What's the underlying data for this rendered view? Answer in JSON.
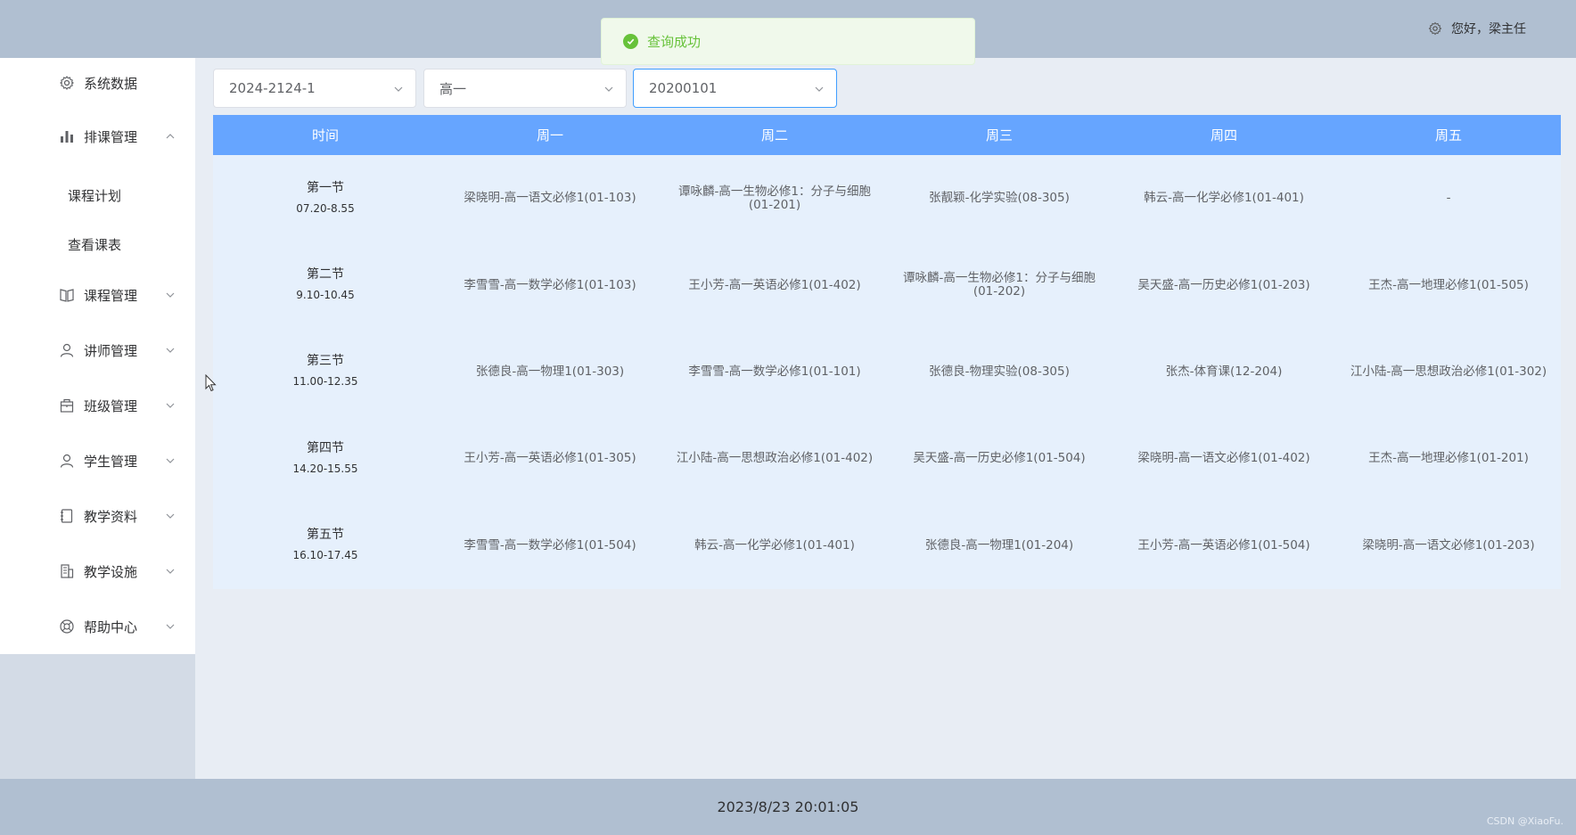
{
  "header": {
    "greeting": "您好，梁主任",
    "settings_icon": "gear-icon"
  },
  "toast": {
    "message": "查询成功",
    "color": "#67c23a",
    "icon": "check-circle-icon"
  },
  "sidebar": {
    "items": [
      {
        "label": "系统数据",
        "icon": "gear-icon",
        "expanded": null
      },
      {
        "label": "排课管理",
        "icon": "bar-chart-icon",
        "expanded": true
      },
      {
        "label": "课程管理",
        "icon": "book-icon",
        "expanded": false
      },
      {
        "label": "讲师管理",
        "icon": "user-icon",
        "expanded": false
      },
      {
        "label": "班级管理",
        "icon": "building-icon",
        "expanded": false
      },
      {
        "label": "学生管理",
        "icon": "user-icon",
        "expanded": false
      },
      {
        "label": "教学资料",
        "icon": "notebook-icon",
        "expanded": false
      },
      {
        "label": "教学设施",
        "icon": "office-icon",
        "expanded": false
      },
      {
        "label": "帮助中心",
        "icon": "help-buoy-icon",
        "expanded": false
      }
    ],
    "subitems": [
      {
        "label": "课程计划"
      },
      {
        "label": "查看课表"
      }
    ]
  },
  "filters": {
    "term": "2024-2124-1",
    "grade": "高一",
    "class_id": "20200101"
  },
  "timetable": {
    "headers": [
      "时间",
      "周一",
      "周二",
      "周三",
      "周四",
      "周五"
    ],
    "rows": [
      {
        "period": "第一节",
        "time": "07.20-8.55",
        "cells": [
          "梁晓明-高一语文必修1(01-103)",
          "谭咏麟-高一生物必修1：分子与细胞(01-201)",
          "张靓颖-化学实验(08-305)",
          "韩云-高一化学必修1(01-401)",
          "-"
        ]
      },
      {
        "period": "第二节",
        "time": "9.10-10.45",
        "cells": [
          "李雪雪-高一数学必修1(01-103)",
          "王小芳-高一英语必修1(01-402)",
          "谭咏麟-高一生物必修1：分子与细胞(01-202)",
          "吴天盛-高一历史必修1(01-203)",
          "王杰-高一地理必修1(01-505)"
        ]
      },
      {
        "period": "第三节",
        "time": "11.00-12.35",
        "cells": [
          "张德良-高一物理1(01-303)",
          "李雪雪-高一数学必修1(01-101)",
          "张德良-物理实验(08-305)",
          "张杰-体育课(12-204)",
          "江小陆-高一思想政治必修1(01-302)"
        ]
      },
      {
        "period": "第四节",
        "time": "14.20-15.55",
        "cells": [
          "王小芳-高一英语必修1(01-305)",
          "江小陆-高一思想政治必修1(01-402)",
          "吴天盛-高一历史必修1(01-504)",
          "梁晓明-高一语文必修1(01-402)",
          "王杰-高一地理必修1(01-201)"
        ]
      },
      {
        "period": "第五节",
        "time": "16.10-17.45",
        "cells": [
          "李雪雪-高一数学必修1(01-504)",
          "韩云-高一化学必修1(01-401)",
          "张德良-高一物理1(01-204)",
          "王小芳-高一英语必修1(01-504)",
          "梁晓明-高一语文必修1(01-203)"
        ]
      }
    ]
  },
  "footer": {
    "datetime": "2023/8/23 20:01:05",
    "watermark": "CSDN @XiaoFu."
  },
  "colors": {
    "header_bg": "#b0bfd1",
    "table_header": "#66a5ff",
    "table_body": "#e6f0fc",
    "active_border": "#409eff"
  }
}
